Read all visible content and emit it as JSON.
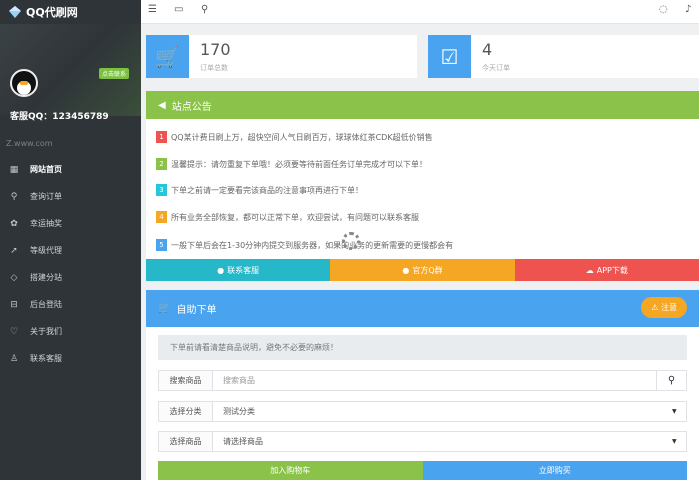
{
  "brand": {
    "title": "QQ代刷网"
  },
  "profile": {
    "badge": "点击联系",
    "kefu": "客服QQ：123456789"
  },
  "site_url": "Z.www.com",
  "nav": [
    {
      "label": "网站首页",
      "icon": "grid-icon",
      "active": true
    },
    {
      "label": "查询订单",
      "icon": "search-icon",
      "active": false
    },
    {
      "label": "幸运抽奖",
      "icon": "gift-icon",
      "active": false
    },
    {
      "label": "等级代理",
      "icon": "rocket-icon",
      "active": false
    },
    {
      "label": "搭建分站",
      "icon": "diamond-icon",
      "active": false
    },
    {
      "label": "后台登陆",
      "icon": "lock-icon",
      "active": false
    },
    {
      "label": "关于我们",
      "icon": "heart-icon",
      "active": false
    },
    {
      "label": "联系客服",
      "icon": "user-icon",
      "active": false
    }
  ],
  "stats": [
    {
      "value": "170",
      "label": "订单总数",
      "color": "#4aa3ee"
    },
    {
      "value": "4",
      "label": "今天订单",
      "color": "#4aa3ee"
    }
  ],
  "notice": {
    "title": "站点公告",
    "items": [
      {
        "num": "1",
        "text": "QQ某计费日刷上万，超快空间人气日刷百万，球球体红茶CDK超低价销售",
        "color": "#ef5350"
      },
      {
        "num": "2",
        "text": "温馨提示：请勿重复下单哦！必须要等待前面任务订单完成才可以下单！",
        "color": "#8bc34a"
      },
      {
        "num": "3",
        "text": "下单之前请一定要看完该商品的注意事项再进行下单！",
        "color": "#26c6da"
      },
      {
        "num": "4",
        "text": "所有业务全部恢复，都可以正常下单，欢迎尝试，有问题可以联系客服",
        "color": "#f5a623"
      },
      {
        "num": "5",
        "text": "一般下单后会在1-30分钟内提交到服务器，如果的业务的更新需要的更慢都会有",
        "color": "#4aa3ee"
      }
    ],
    "buttons": [
      {
        "label": "联系客服",
        "color": "#26b8c8"
      },
      {
        "label": "官方Q群",
        "color": "#f5a623"
      },
      {
        "label": "APP下载",
        "color": "#ef5350"
      }
    ]
  },
  "order": {
    "title": "自助下单",
    "warn_label": "注意",
    "tip": "下单前请看清楚商品说明，避免不必要的麻烦！",
    "search_label": "搜索商品",
    "search_placeholder": "搜索商品",
    "category_label": "选择分类",
    "category_value": "测试分类",
    "product_label": "选择商品",
    "product_value": "请选择商品",
    "add_cart": "加入购物车",
    "buy_now": "立即购买"
  }
}
